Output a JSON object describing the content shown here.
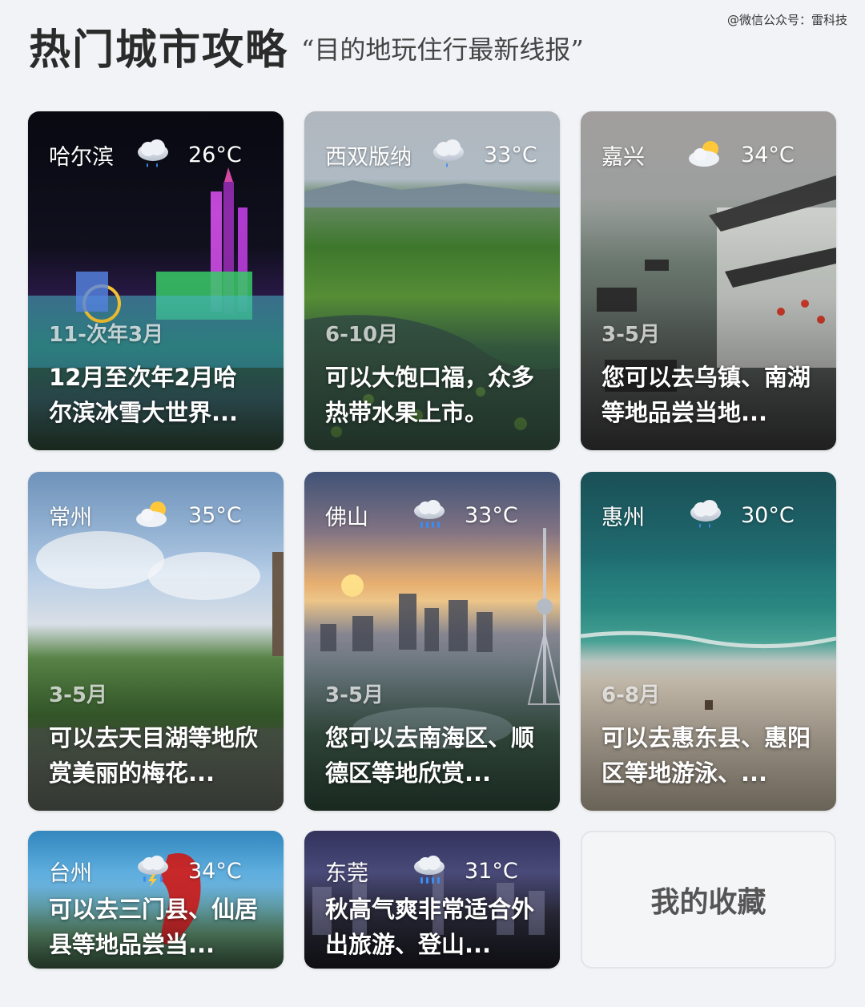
{
  "watermark": "@微信公众号：雷科技",
  "header": {
    "title": "热门城市攻略",
    "subtitle": "“目的地玩住行最新线报”"
  },
  "cards": [
    {
      "city": "哈尔滨",
      "weather_icon": "rain-cloud-icon",
      "temp": "26°C",
      "months": "11-次年3月",
      "desc": "12月至次年2月哈尔滨冰雪大世界..."
    },
    {
      "city": "西双版纳",
      "weather_icon": "rain-cloud-icon",
      "temp": "33°C",
      "months": "6-10月",
      "desc": "可以大饱口福，众多热带水果上市。"
    },
    {
      "city": "嘉兴",
      "weather_icon": "partly-cloudy-icon",
      "temp": "34°C",
      "months": "3-5月",
      "desc": "您可以去乌镇、南湖等地品尝当地..."
    },
    {
      "city": "常州",
      "weather_icon": "partly-cloudy-icon",
      "temp": "35°C",
      "months": "3-5月",
      "desc": "可以去天目湖等地欣赏美丽的梅花..."
    },
    {
      "city": "佛山",
      "weather_icon": "heavy-rain-icon",
      "temp": "33°C",
      "months": "3-5月",
      "desc": "您可以去南海区、顺德区等地欣赏..."
    },
    {
      "city": "惠州",
      "weather_icon": "rain-cloud-icon",
      "temp": "30°C",
      "months": "6-8月",
      "desc": "可以去惠东县、惠阳区等地游泳、..."
    },
    {
      "city": "台州",
      "weather_icon": "thunderstorm-icon",
      "temp": "34°C",
      "desc": "可以去三门县、仙居县等地品尝当..."
    },
    {
      "city": "东莞",
      "weather_icon": "heavy-rain-icon",
      "temp": "31°C",
      "desc": "秋高气爽非常适合外出旅游、登山..."
    }
  ],
  "favorites_label": "我的收藏"
}
